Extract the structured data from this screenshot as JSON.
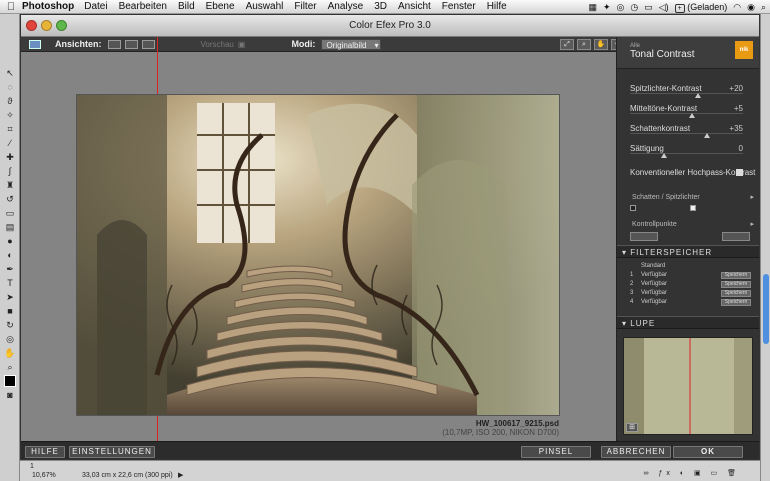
{
  "menubar": {
    "app": "Photoshop",
    "items": [
      "Datei",
      "Bearbeiten",
      "Bild",
      "Ebene",
      "Auswahl",
      "Filter",
      "Analyse",
      "3D",
      "Ansicht",
      "Fenster",
      "Hilfe"
    ],
    "battery": "(Geladen)"
  },
  "window": {
    "title": "Color Efex Pro 3.0"
  },
  "topbar": {
    "views_label": "Ansichten:",
    "preview_label": "Vorschau",
    "modes_label": "Modi:",
    "mode_value": "Originalbild"
  },
  "image": {
    "filename": "HW_100617_9215.psd",
    "meta": "(10,7MP, ISO 200, NIKON D700)"
  },
  "filter": {
    "category": "Alle",
    "name": "Tonal Contrast",
    "brand": "nik",
    "sliders": [
      {
        "label": "Spitzlichter-Kontrast",
        "value": "+20",
        "pos": 0.6
      },
      {
        "label": "Mitteltöne-Kontrast",
        "value": "+5",
        "pos": 0.55
      },
      {
        "label": "Schattenkontrast",
        "value": "+35",
        "pos": 0.68
      },
      {
        "label": "Sättigung",
        "value": "0",
        "pos": 0.3
      }
    ],
    "checkbox_label": "Konventioneller Hochpass-Kontrast",
    "shadows_highlights": "Schatten / Spitzlichter",
    "control_points": "Kontrollpunkte"
  },
  "filter_storage": {
    "header": "FILTERSPEICHER",
    "standard": "Standard",
    "slots": [
      {
        "num": "1",
        "name": "Verfügbar",
        "button": "Speichern"
      },
      {
        "num": "2",
        "name": "Verfügbar",
        "button": "Speichern"
      },
      {
        "num": "3",
        "name": "Verfügbar",
        "button": "Speichern"
      },
      {
        "num": "4",
        "name": "Verfügbar",
        "button": "Speichern"
      }
    ]
  },
  "loupe": {
    "header": "LUPE"
  },
  "bottom": {
    "help": "HILFE",
    "settings": "EINSTELLUNGEN",
    "brush": "PINSEL",
    "cancel": "ABBRECHEN",
    "ok": "OK"
  },
  "ps_status": {
    "page": "1",
    "zoom": "10,67%",
    "doc_size": "33,03 cm x 22,6 cm (300 ppi)"
  },
  "colors": {
    "accent": "#e89a12",
    "guide": "#dd2222"
  }
}
